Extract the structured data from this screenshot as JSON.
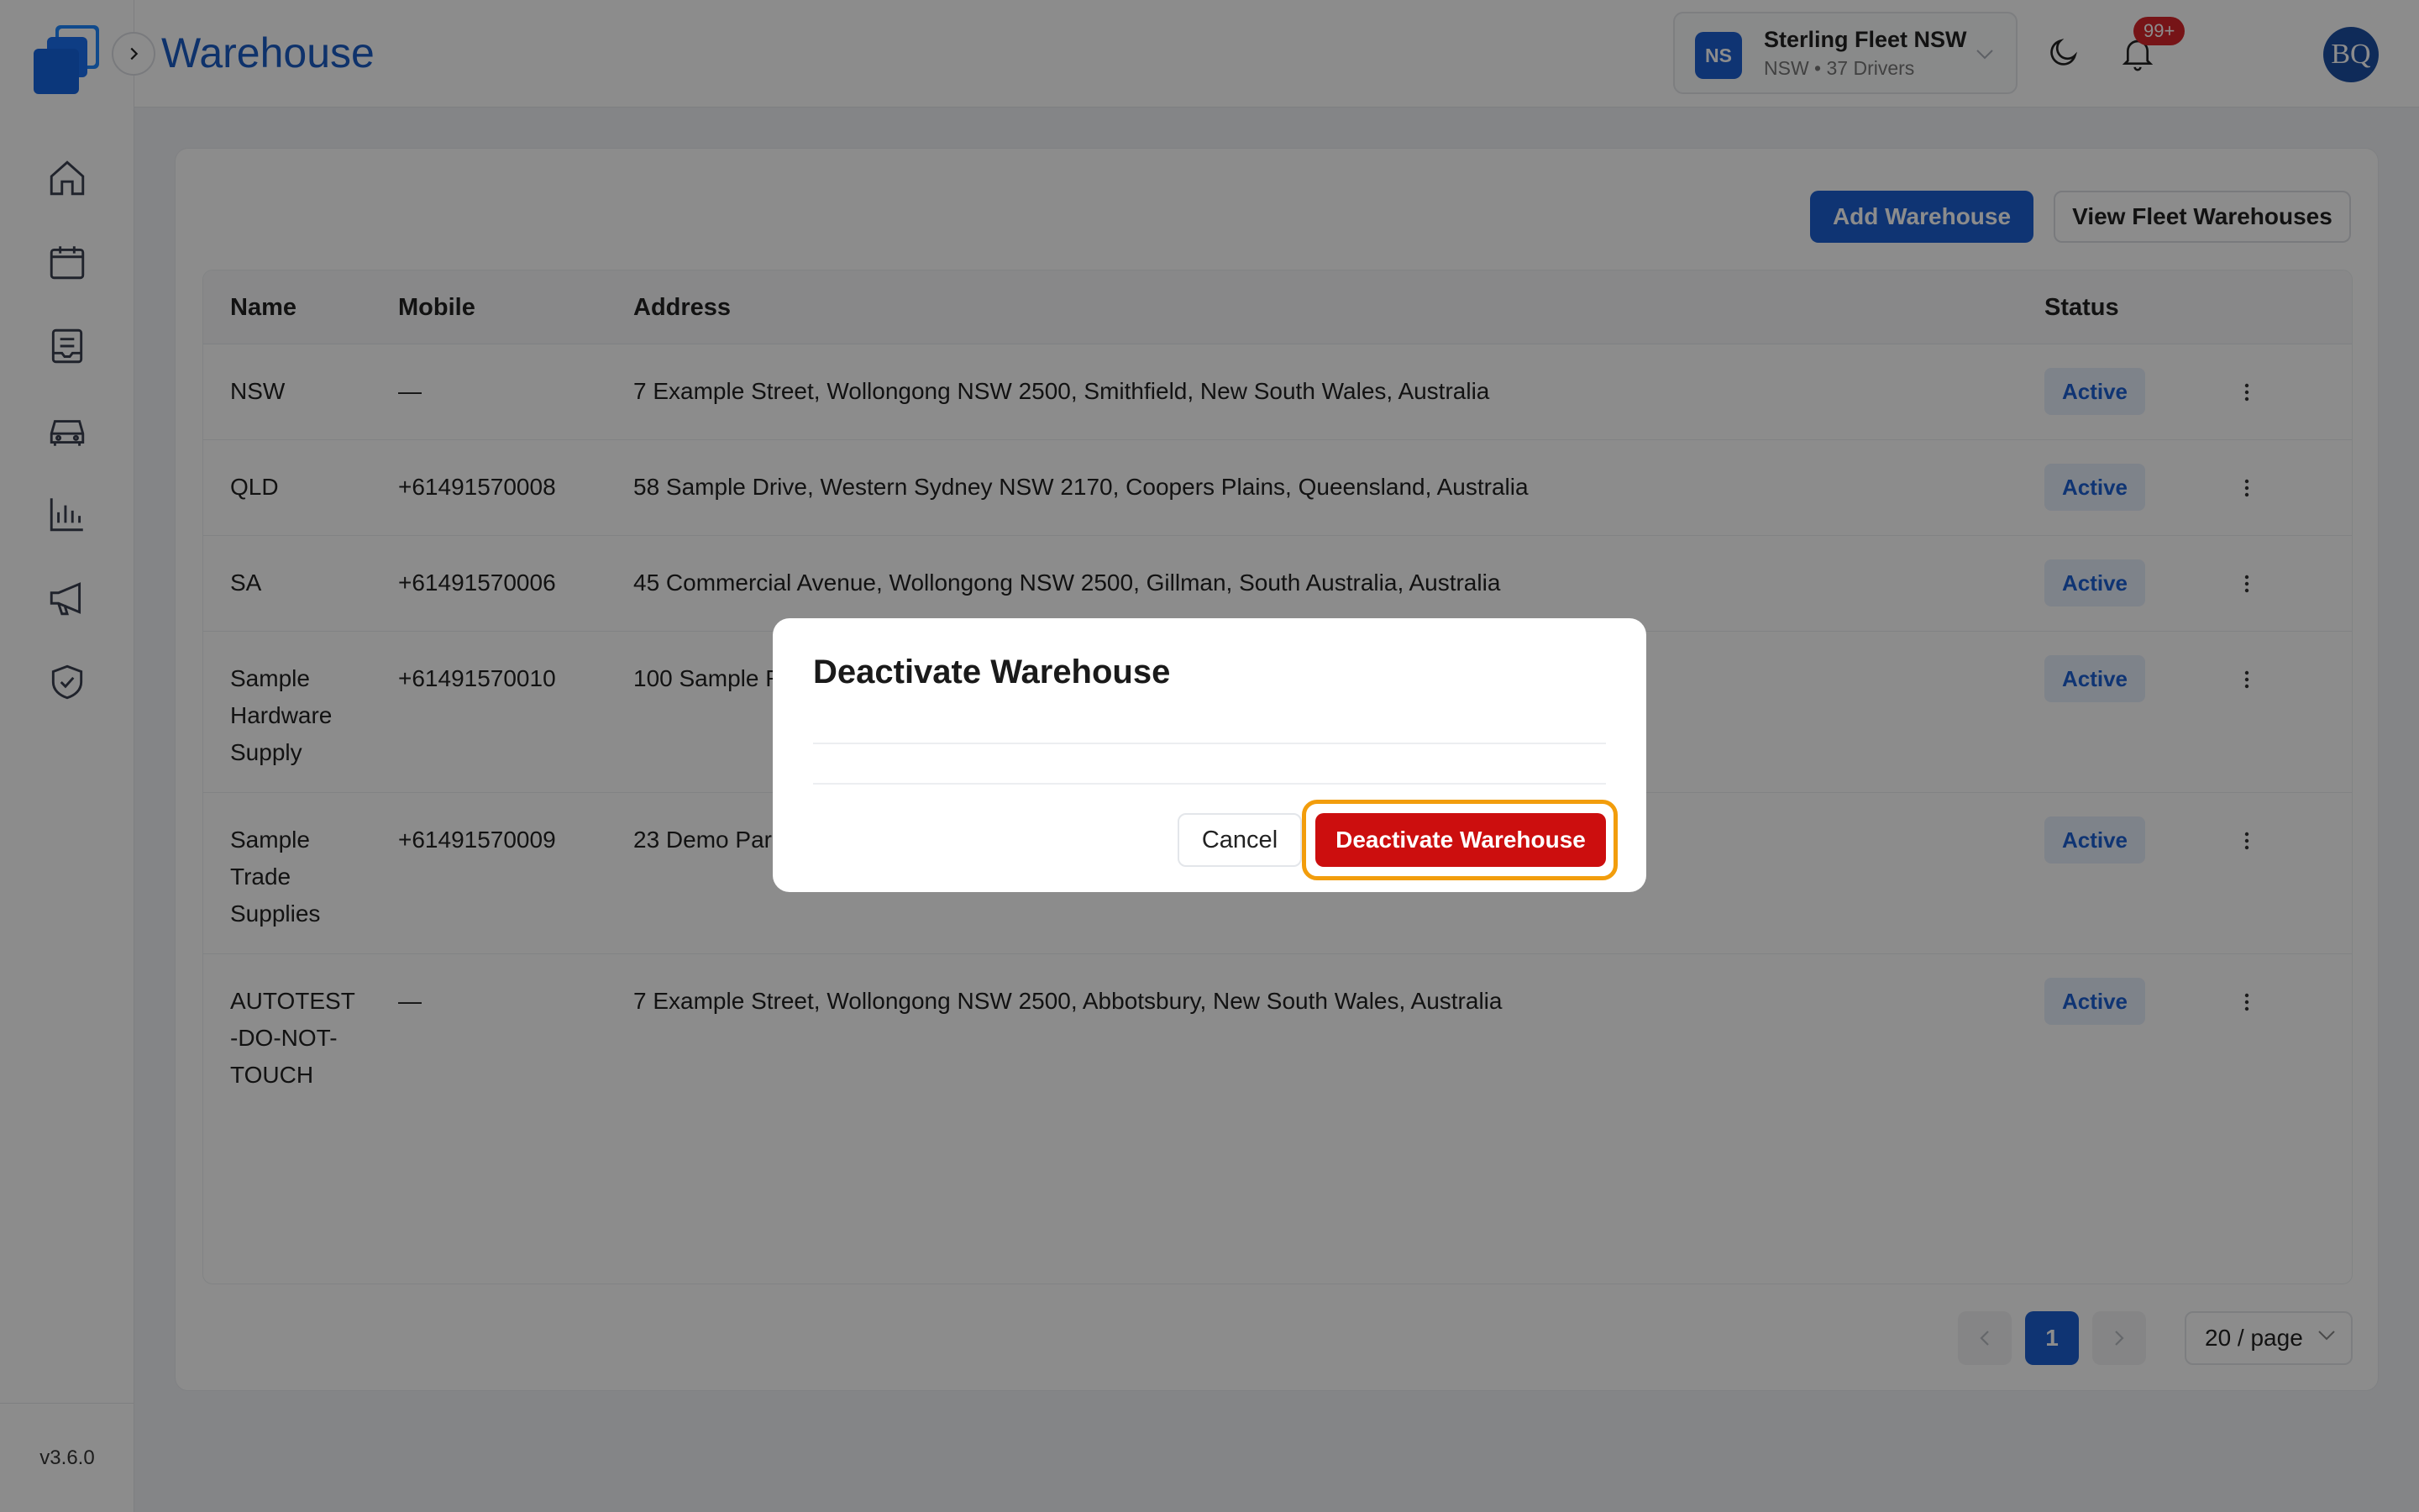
{
  "header": {
    "title": "Warehouse",
    "fleet": {
      "initials": "NS",
      "name": "Sterling Fleet NSW",
      "subtitle": "NSW • 37 Drivers"
    },
    "notifications": "99+",
    "avatar": "BQ"
  },
  "sidebar": {
    "items": [
      {
        "icon": "home-icon"
      },
      {
        "icon": "calendar-icon"
      },
      {
        "icon": "orders-icon"
      },
      {
        "icon": "vehicle-icon"
      },
      {
        "icon": "reports-icon"
      },
      {
        "icon": "megaphone-icon"
      },
      {
        "icon": "shield-check-icon"
      }
    ],
    "version": "v3.6.0"
  },
  "toolbar": {
    "add_label": "Add Warehouse",
    "view_label": "View Fleet Warehouses"
  },
  "table": {
    "columns": [
      "Name",
      "Mobile",
      "Address",
      "Status"
    ],
    "rows": [
      {
        "name": "NSW",
        "mobile": "—",
        "address": "7 Example Street, Wollongong NSW 2500, Smithfield, New South Wales, Australia",
        "status": "Active"
      },
      {
        "name": "QLD",
        "mobile": "+61491570008",
        "address": "58 Sample Drive, Western Sydney NSW 2170, Coopers Plains, Queensland, Australia",
        "status": "Active"
      },
      {
        "name": "SA",
        "mobile": "+61491570006",
        "address": "45 Commercial Avenue, Wollongong NSW 2500, Gillman, South Australia, Australia",
        "status": "Active"
      },
      {
        "name_lines": [
          "Sample",
          "Hardware",
          "Supply"
        ],
        "mobile": "+61491570010",
        "address": "100 Sample R",
        "status": "Active"
      },
      {
        "name_lines": [
          "Sample",
          "Trade",
          "Supplies"
        ],
        "mobile": "+61491570009",
        "address": "23 Demo Para",
        "status": "Active"
      },
      {
        "name_lines": [
          "AUTOTEST",
          "-DO-NOT-",
          "TOUCH"
        ],
        "mobile": "—",
        "address": "7 Example Street, Wollongong NSW 2500, Abbotsbury, New South Wales, Australia",
        "status": "Active"
      }
    ]
  },
  "pagination": {
    "current_page": "1",
    "page_size": "20 / page"
  },
  "modal": {
    "title": "Deactivate Warehouse",
    "cancel_label": "Cancel",
    "confirm_label": "Deactivate Warehouse"
  },
  "colors": {
    "accent": "#1c5fd1",
    "danger": "#cc0e0e",
    "focus_ring": "#f29d0c"
  }
}
